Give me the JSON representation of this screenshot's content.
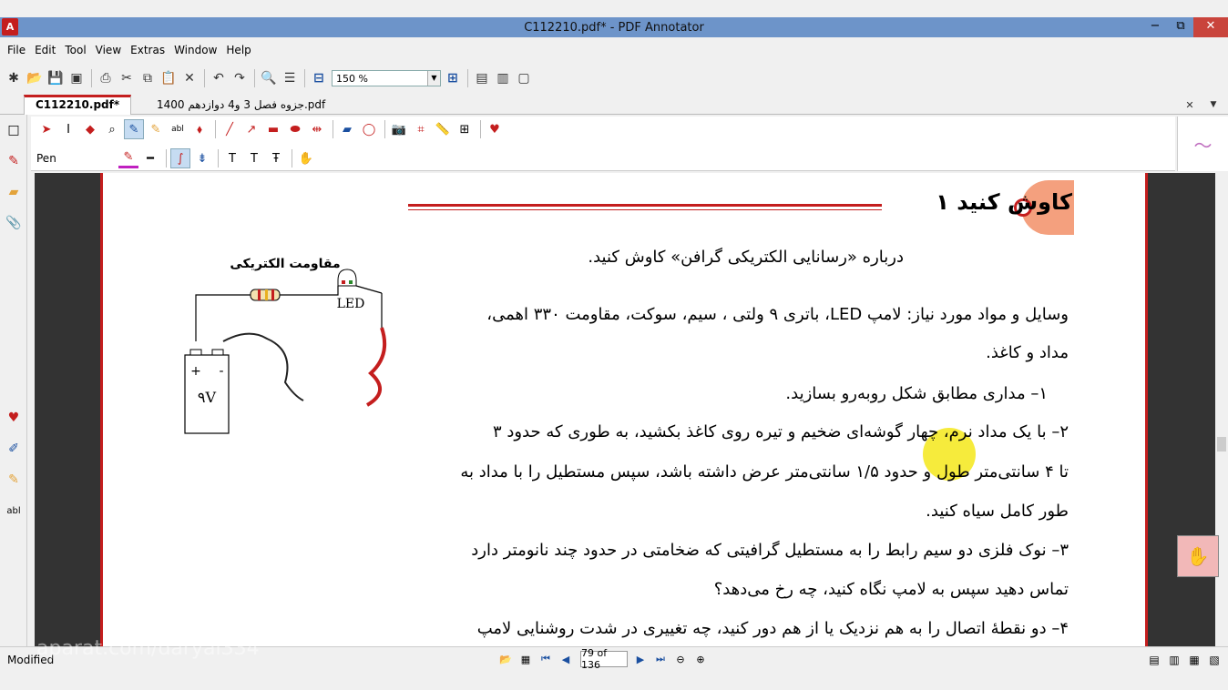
{
  "window": {
    "title": "C112210.pdf* - PDF Annotator",
    "controls": [
      "−",
      "⧉",
      "✕"
    ]
  },
  "menu": [
    "File",
    "Edit",
    "Tool",
    "View",
    "Extras",
    "Window",
    "Help"
  ],
  "toolbar": {
    "zoom": "150 %"
  },
  "tabs": [
    {
      "label": "C112210.pdf*"
    },
    {
      "label": "جزوه فصل 3 و4 دوازدهم 1400.pdf"
    }
  ],
  "annotation_bar": {
    "tool_label": "Pen"
  },
  "document": {
    "heading": "کاوش کنید ۱",
    "lines": [
      "درباره «رسانایی الکتریکی گرافن» کاوش کنید.",
      "وسایل و مواد مورد نیاز: لامپ LED، باتری ۹ ولتی ، سیم، سوکت، مقاومت ۳۳۰ اهمی،",
      "مداد و کاغذ.",
      "۱– مداری مطابق شکل روبه‌رو بسازید.",
      "۲– با یک مداد نرم، چهار گوشه‌ای ضخیم و تیره روی کاغذ بکشید، به طوری که حدود ۳",
      "تا ۴ سانتی‌متر طول و حدود ۱/۵ سانتی‌متر عرض داشته باشد، سپس مستطیل را با مداد به",
      "طور کامل سیاه کنید.",
      "۳– نوک فلزی دو سیم رابط را به مستطیل گرافیتی که ضخامتی در حدود چند نانومتر دارد",
      "تماس دهید سپس به لامپ نگاه کنید، چه رخ می‌دهد؟",
      "۴– دو نقطهٔ اتصال را به هم نزدیک یا از هم دور کنید، چه تغییری در شدت روشنایی لامپ"
    ],
    "circuit": {
      "resistor_label": "مقاومت الکتریکی",
      "led_label": "LED",
      "battery_label": "۹V",
      "plus": "+",
      "minus": "-"
    }
  },
  "status": {
    "text": "Modified",
    "page": "79 of 136"
  },
  "watermark": "aparat.com/daryal334"
}
